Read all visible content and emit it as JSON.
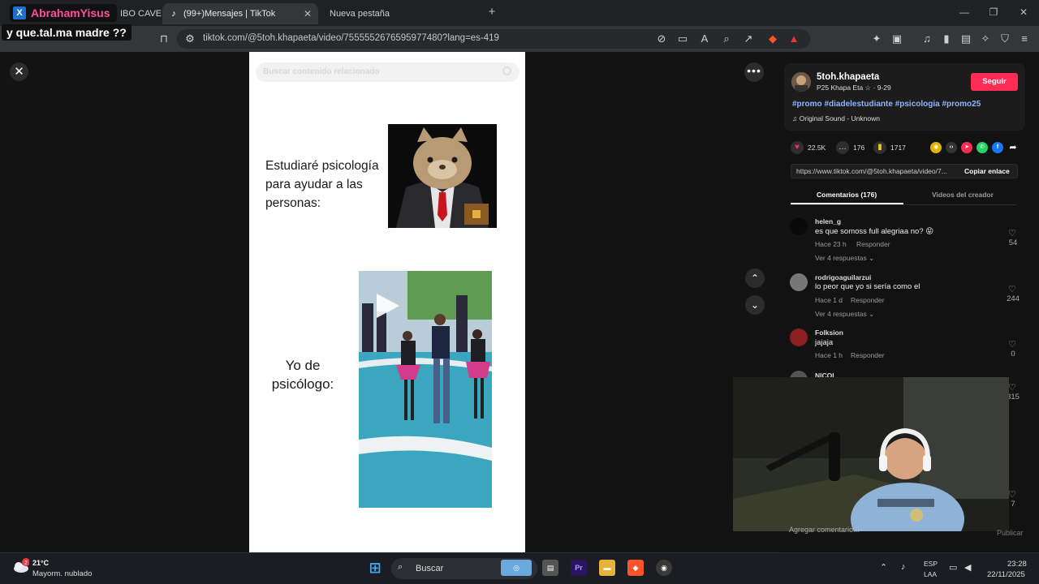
{
  "overlay": {
    "channel_name": "AbrahamYisus",
    "caption": "y que.tal.ma madre ??"
  },
  "tabs": [
    {
      "label": "IBO CAVE",
      "active": false
    },
    {
      "label": "(99+)Mensajes | TikTok",
      "active": true
    },
    {
      "label": "Nueva pestaña",
      "active": false
    }
  ],
  "address_bar": {
    "url": "tiktok.com/@5toh.khapaeta/video/7555552676595977480?lang=es-419"
  },
  "video": {
    "search_placeholder": "Buscar contenido relacionado",
    "caption_top": "Estudiaré psicología para ayudar a las personas:",
    "caption_bottom": "Yo de psicólogo:"
  },
  "creator": {
    "username": "5toh.khapaeta",
    "subtitle": "P25 Khapa Eta ☆ · 9-29",
    "follow_label": "Seguir",
    "hashtags": "#promo #diadelestudiante #psicologia #promo25",
    "sound": "Original Sound - Unknown"
  },
  "stats": {
    "likes": "22.5K",
    "comments": "176",
    "saves": "1717"
  },
  "share": {
    "link": "https://www.tiktok.com/@5toh.khapaeta/video/7...",
    "copy_label": "Copiar enlace"
  },
  "panel_tabs": {
    "comments": "Comentarios (176)",
    "creator_videos": "Videos del creador"
  },
  "comments": [
    {
      "user": "helen_g",
      "text": "es que somoss full alegriaa no? 😝",
      "time": "Hace 23 h",
      "reply": "Responder",
      "more": "Ver 4 respuestas ⌄",
      "likes": "54"
    },
    {
      "user": "rodrigoaguilarzui",
      "text": "lo peor que yo si sería como el",
      "time": "Hace 1 d",
      "reply": "Responder",
      "more": "Ver 4 respuestas ⌄",
      "likes": "244"
    },
    {
      "user": "Folksion",
      "text": "jajaja",
      "time": "Hace 1 h",
      "reply": "Responder",
      "more": "",
      "likes": "0"
    },
    {
      "user": "NICOL",
      "text": "",
      "time": "",
      "reply": "",
      "more": "",
      "likes": "315"
    }
  ],
  "extra_like_count": "7",
  "comment_input": {
    "placeholder": "Agregar comentario...",
    "post_label": "Publicar"
  },
  "taskbar": {
    "temperature": "21°C",
    "weather": "Mayorm. nublado",
    "weather_badge": "2",
    "search_label": "Buscar",
    "lang_top": "ESP",
    "lang_bottom": "LAA",
    "time": "23:28",
    "date": "22/11/2025"
  },
  "colors": {
    "accent_pink": "#fe2c55",
    "hashtag_blue": "#8fb4ff",
    "channel_pink": "#ff4fa0"
  }
}
